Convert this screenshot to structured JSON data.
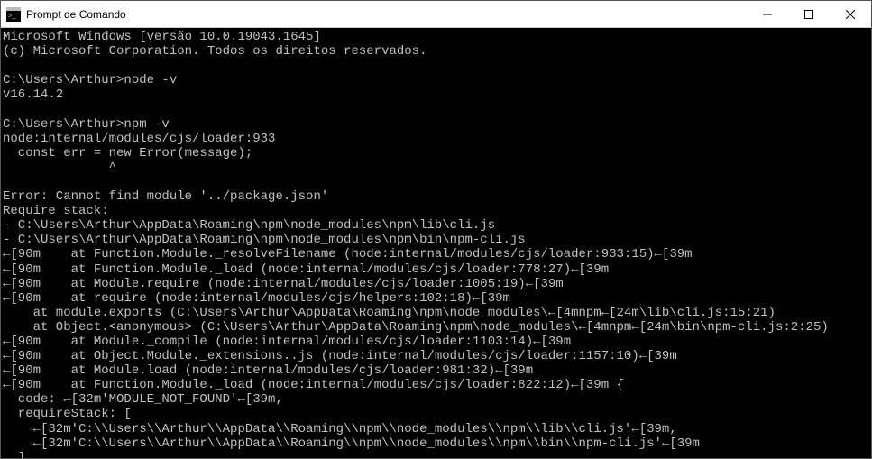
{
  "window": {
    "title": "Prompt de Comando",
    "icon_name": "cmd-icon"
  },
  "terminal": {
    "lines": [
      "Microsoft Windows [versão 10.0.19043.1645]",
      "(c) Microsoft Corporation. Todos os direitos reservados.",
      "",
      "C:\\Users\\Arthur>node -v",
      "v16.14.2",
      "",
      "C:\\Users\\Arthur>npm -v",
      "node:internal/modules/cjs/loader:933",
      "  const err = new Error(message);",
      "              ^",
      "",
      "Error: Cannot find module '../package.json'",
      "Require stack:",
      "- C:\\Users\\Arthur\\AppData\\Roaming\\npm\\node_modules\\npm\\lib\\cli.js",
      "- C:\\Users\\Arthur\\AppData\\Roaming\\npm\\node_modules\\npm\\bin\\npm-cli.js",
      "←[90m    at Function.Module._resolveFilename (node:internal/modules/cjs/loader:933:15)←[39m",
      "←[90m    at Function.Module._load (node:internal/modules/cjs/loader:778:27)←[39m",
      "←[90m    at Module.require (node:internal/modules/cjs/loader:1005:19)←[39m",
      "←[90m    at require (node:internal/modules/cjs/helpers:102:18)←[39m",
      "    at module.exports (C:\\Users\\Arthur\\AppData\\Roaming\\npm\\node_modules\\←[4mnpm←[24m\\lib\\cli.js:15:21)",
      "    at Object.<anonymous> (C:\\Users\\Arthur\\AppData\\Roaming\\npm\\node_modules\\←[4mnpm←[24m\\bin\\npm-cli.js:2:25)",
      "←[90m    at Module._compile (node:internal/modules/cjs/loader:1103:14)←[39m",
      "←[90m    at Object.Module._extensions..js (node:internal/modules/cjs/loader:1157:10)←[39m",
      "←[90m    at Module.load (node:internal/modules/cjs/loader:981:32)←[39m",
      "←[90m    at Function.Module._load (node:internal/modules/cjs/loader:822:12)←[39m {",
      "  code: ←[32m'MODULE_NOT_FOUND'←[39m,",
      "  requireStack: [",
      "    ←[32m'C:\\\\Users\\\\Arthur\\\\AppData\\\\Roaming\\\\npm\\\\node_modules\\\\npm\\\\lib\\\\cli.js'←[39m,",
      "    ←[32m'C:\\\\Users\\\\Arthur\\\\AppData\\\\Roaming\\\\npm\\\\node_modules\\\\npm\\\\bin\\\\npm-cli.js'←[39m",
      "  ]"
    ]
  }
}
